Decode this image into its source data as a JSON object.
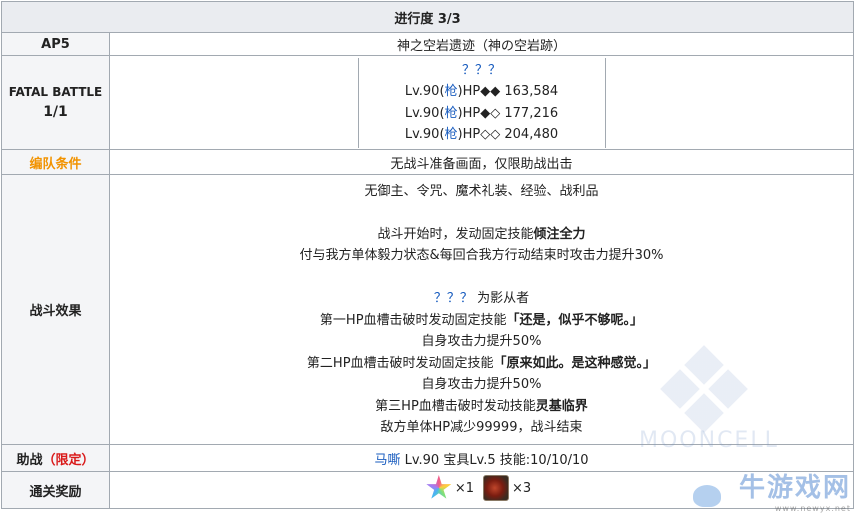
{
  "header": {
    "progress": "进行度 3/3"
  },
  "ap": {
    "label": "AP5",
    "quest_name": "神之空岩遗迹（神の空岩跡）"
  },
  "fatal_battle": {
    "title": "FATAL BATTLE",
    "count": "1/1",
    "enemy_name": "？？？",
    "enemies": [
      {
        "level": "Lv.90(",
        "class": "枪",
        "hp_label": ")HP◆◆",
        "hp": "163,584"
      },
      {
        "level": "Lv.90(",
        "class": "枪",
        "hp_label": ")HP◆◇",
        "hp": "177,216"
      },
      {
        "level": "Lv.90(",
        "class": "枪",
        "hp_label": ")HP◇◇",
        "hp": "204,480"
      }
    ]
  },
  "formation": {
    "label": "编队条件",
    "text": "无战斗准备画面，仅限助战出击"
  },
  "effects": {
    "label": "战斗效果",
    "l1": "无御主、令咒、魔术礼装、经验、战利品",
    "l2_pre": "战斗开始时，发动固定技能",
    "l2_skill": "倾注全力",
    "l3": "付与我方单体毅力状态&每回合我方行动结束时攻击力提升30%",
    "l4_name": "？？？",
    "l4_rest": " 为影从者",
    "l5_pre": "第一HP血槽击破时发动固定技能",
    "l5_skill": "「还是，似乎不够呢。」",
    "l6": "自身攻击力提升50%",
    "l7_pre": "第二HP血槽击破时发动固定技能",
    "l7_skill": "「原来如此。是这种感觉。」",
    "l8": "自身攻击力提升50%",
    "l9_pre": "第三HP血槽击破时发动技能",
    "l9_skill": "灵基临界",
    "l10": "敌方单体HP减少99999，战斗结束"
  },
  "support": {
    "label": "助战",
    "limited": "（限定）",
    "servant": "马嘶",
    "details": " Lv.90 宝具Lv.5 技能:10/10/10"
  },
  "rewards": {
    "label": "通关奖励",
    "items": [
      {
        "icon": "saint-quartz-icon",
        "qty": "×1"
      },
      {
        "icon": "material-icon",
        "qty": "×3"
      }
    ]
  },
  "watermark": {
    "text": "MOONCELL",
    "site": "牛游戏网",
    "url": "www.newyx.net"
  },
  "colors": {
    "orange": "#f29300",
    "red": "#d91a1a",
    "blue": "#1a5dbf",
    "header_bg": "#eaecf0"
  }
}
